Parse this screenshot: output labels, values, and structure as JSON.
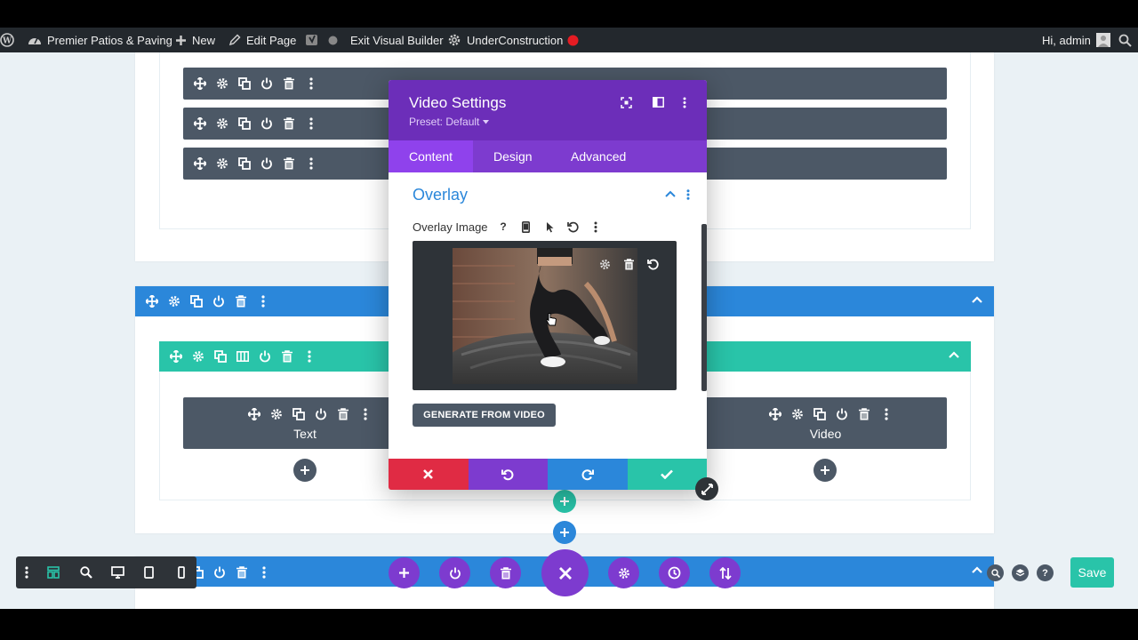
{
  "adminbar": {
    "site_name": "Premier Patios & Paving",
    "new_label": "New",
    "edit_page_label": "Edit Page",
    "exit_vb_label": "Exit Visual Builder",
    "under_construction_label": "UnderConstruction",
    "greeting": "Hi, admin"
  },
  "modal": {
    "title": "Video Settings",
    "preset": "Preset: Default",
    "tabs": [
      {
        "label": "Content",
        "active": true
      },
      {
        "label": "Design",
        "active": false
      },
      {
        "label": "Advanced",
        "active": false
      }
    ],
    "group_title": "Overlay",
    "field_label": "Overlay Image",
    "help_mark": "?",
    "generate_button": "GENERATE FROM VIDEO"
  },
  "modules": {
    "left_label": "Text",
    "right_label": "Video"
  },
  "toolbar": {
    "save_label": "Save"
  },
  "colors": {
    "purple": "#6c2eb9",
    "purple_light": "#8f42ec",
    "blue": "#2b87da",
    "green": "#29c4a9",
    "red": "#e02b44",
    "dark": "#4c5866"
  }
}
